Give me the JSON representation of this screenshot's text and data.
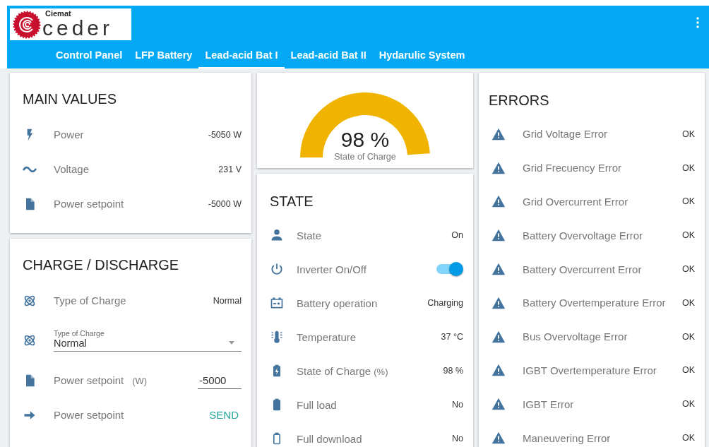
{
  "header": {
    "logo": {
      "small": "Ciemat",
      "big": "ceder"
    },
    "tabs": [
      {
        "label": "Control Panel",
        "selected": false
      },
      {
        "label": "LFP Battery",
        "selected": false
      },
      {
        "label": "Lead-acid Bat I",
        "selected": true
      },
      {
        "label": "Lead-acid Bat II",
        "selected": false
      },
      {
        "label": "Hydarulic System",
        "selected": false
      }
    ]
  },
  "main_values": {
    "title": "MAIN VALUES",
    "rows": [
      {
        "label": "Power",
        "value": "-5050 W"
      },
      {
        "label": "Voltage",
        "value": "231 V"
      },
      {
        "label": "Power setpoint",
        "value": "-5000 W"
      }
    ]
  },
  "charge": {
    "title": "CHARGE / DISCHARGE",
    "rows": [
      {
        "kind": "value",
        "label": "Type of Charge",
        "value": "Normal"
      },
      {
        "kind": "select",
        "label": "Type of Charge",
        "value": "Normal"
      },
      {
        "kind": "input",
        "label": "Power setpoint",
        "unit": "(W)",
        "value": "-5000"
      },
      {
        "kind": "action",
        "label": "Power setpoint",
        "button": "SEND"
      }
    ]
  },
  "gauge": {
    "reading": "98 %",
    "caption": "State of Charge"
  },
  "state": {
    "title": "STATE",
    "rows": [
      {
        "kind": "value",
        "label": "State",
        "value": "On"
      },
      {
        "kind": "toggle",
        "label": "Inverter On/Off",
        "on": true
      },
      {
        "kind": "value",
        "label": "Battery operation",
        "value": "Charging"
      },
      {
        "kind": "value",
        "label": "Temperature",
        "value": "37 °C"
      },
      {
        "kind": "value",
        "label": "State of Charge",
        "unit": "(%)",
        "value": "98 %"
      },
      {
        "kind": "value",
        "label": "Full load",
        "value": "No"
      },
      {
        "kind": "value",
        "label": "Full download",
        "value": "No"
      }
    ]
  },
  "errors": {
    "title": "ERRORS",
    "rows": [
      {
        "label": "Grid Voltage Error",
        "value": "OK"
      },
      {
        "label": "Grid Frecuency Error",
        "value": "OK"
      },
      {
        "label": "Grid Overcurrent Error",
        "value": "OK"
      },
      {
        "label": "Battery Overvoltage Error",
        "value": "OK"
      },
      {
        "label": "Battery Overcurrent Error",
        "value": "OK"
      },
      {
        "label": "Battery Overtemperature Error",
        "value": "OK"
      },
      {
        "label": "Bus Overvoltage Error",
        "value": "OK"
      },
      {
        "label": "IGBT Overtemperature Error",
        "value": "OK"
      },
      {
        "label": "IGBT Error",
        "value": "OK"
      },
      {
        "label": "Maneuvering Error",
        "value": "OK"
      }
    ]
  }
}
